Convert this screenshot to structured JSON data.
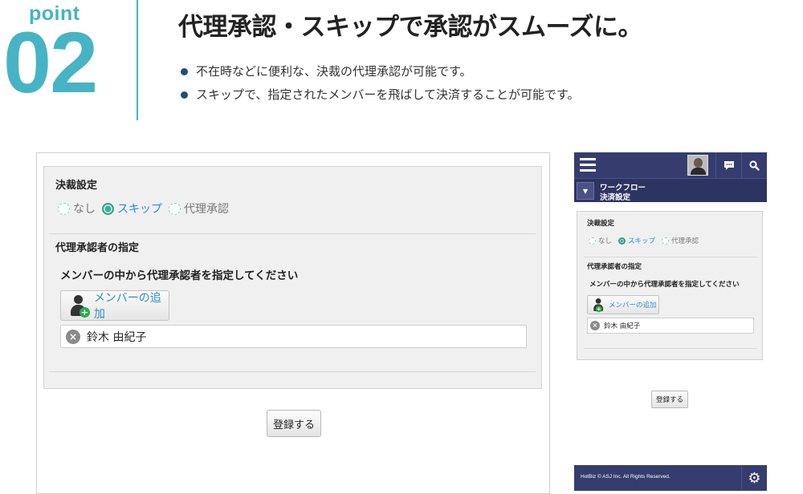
{
  "point": {
    "label": "point",
    "number": "02"
  },
  "headline": "代理承認・スキップで承認がスムーズに。",
  "bullets": [
    "不在時などに便利な、決裁の代理承認が可能です。",
    "スキップで、指定されたメンバーを飛ばして決済することが可能です。"
  ],
  "desktop": {
    "section_decision": "決裁設定",
    "radio_options": [
      {
        "label": "なし",
        "selected": false
      },
      {
        "label": "スキップ",
        "selected": true
      },
      {
        "label": "代理承認",
        "selected": false
      }
    ],
    "section_proxy": "代理承認者の指定",
    "instruction": "メンバーの中から代理承認者を指定してください",
    "add_member_label": "メンバーの追加",
    "member_name": "鈴木 由紀子",
    "submit_label": "登録する"
  },
  "mobile": {
    "breadcrumb_line1": "ワークフロー",
    "breadcrumb_line2": "決済設定",
    "section_decision": "決裁設定",
    "radio_options": [
      {
        "label": "なし",
        "selected": false
      },
      {
        "label": "スキップ",
        "selected": true
      },
      {
        "label": "代理承認",
        "selected": false
      }
    ],
    "section_proxy": "代理承認者の指定",
    "instruction": "メンバーの中から代理承認者を指定してください",
    "add_member_label": "メンバーの追加",
    "member_name": "鈴木 由紀子",
    "submit_label": "登録する",
    "footer_copyright": "HotBiz © ASJ Inc. All Rights Reserved."
  },
  "icons": {
    "menu": "hamburger-icon",
    "avatar": "user-avatar",
    "chat": "chat-bubble-icon",
    "search": "search-icon",
    "settings": "gear-icon",
    "remove": "close-circle-icon",
    "add_user": "add-user-icon"
  },
  "colors": {
    "accent_teal": "#46b4c4",
    "navy": "#353d6e",
    "link_blue": "#2c8fc4",
    "radio_green": "#2f9e87"
  }
}
